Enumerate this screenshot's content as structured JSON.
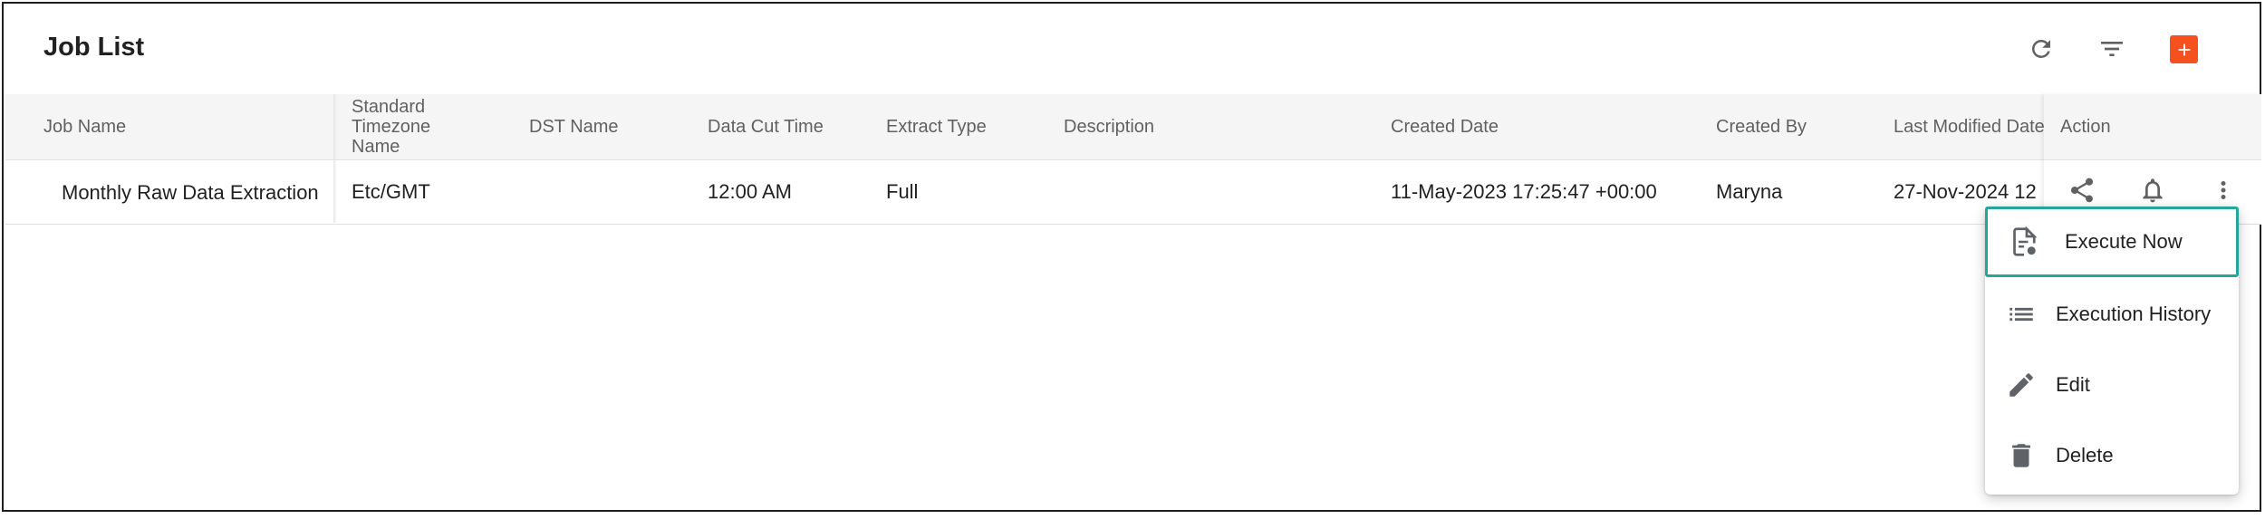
{
  "page": {
    "title": "Job List"
  },
  "toolbar": {
    "refresh_icon": "refresh-icon",
    "filter_icon": "filter-icon",
    "add_icon": "add-icon",
    "add_color": "#f4511e"
  },
  "table": {
    "columns": [
      "Job Name",
      "Standard Timezone Name",
      "DST Name",
      "Data Cut Time",
      "Extract Type",
      "Description",
      "Created Date",
      "Created By",
      "Last Modified Date",
      "Action"
    ],
    "rows": [
      {
        "job_name": "Monthly Raw Data Extraction",
        "timezone": "Etc/GMT",
        "dst_name": "",
        "data_cut_time": "12:00 AM",
        "extract_type": "Full",
        "description": "",
        "created_date": "11-May-2023 17:25:47 +00:00",
        "created_by": "Maryna",
        "last_modified": "27-Nov-2024 12",
        "actions": [
          "share-icon",
          "bell-icon",
          "more-vertical-icon"
        ]
      }
    ]
  },
  "context_menu": {
    "items": [
      {
        "label": "Execute Now",
        "icon": "execute-document-icon",
        "focused": true
      },
      {
        "label": "Execution History",
        "icon": "list-icon"
      },
      {
        "label": "Edit",
        "icon": "pencil-icon"
      },
      {
        "label": "Delete",
        "icon": "trash-icon"
      }
    ],
    "focus_color": "#26a69a"
  }
}
